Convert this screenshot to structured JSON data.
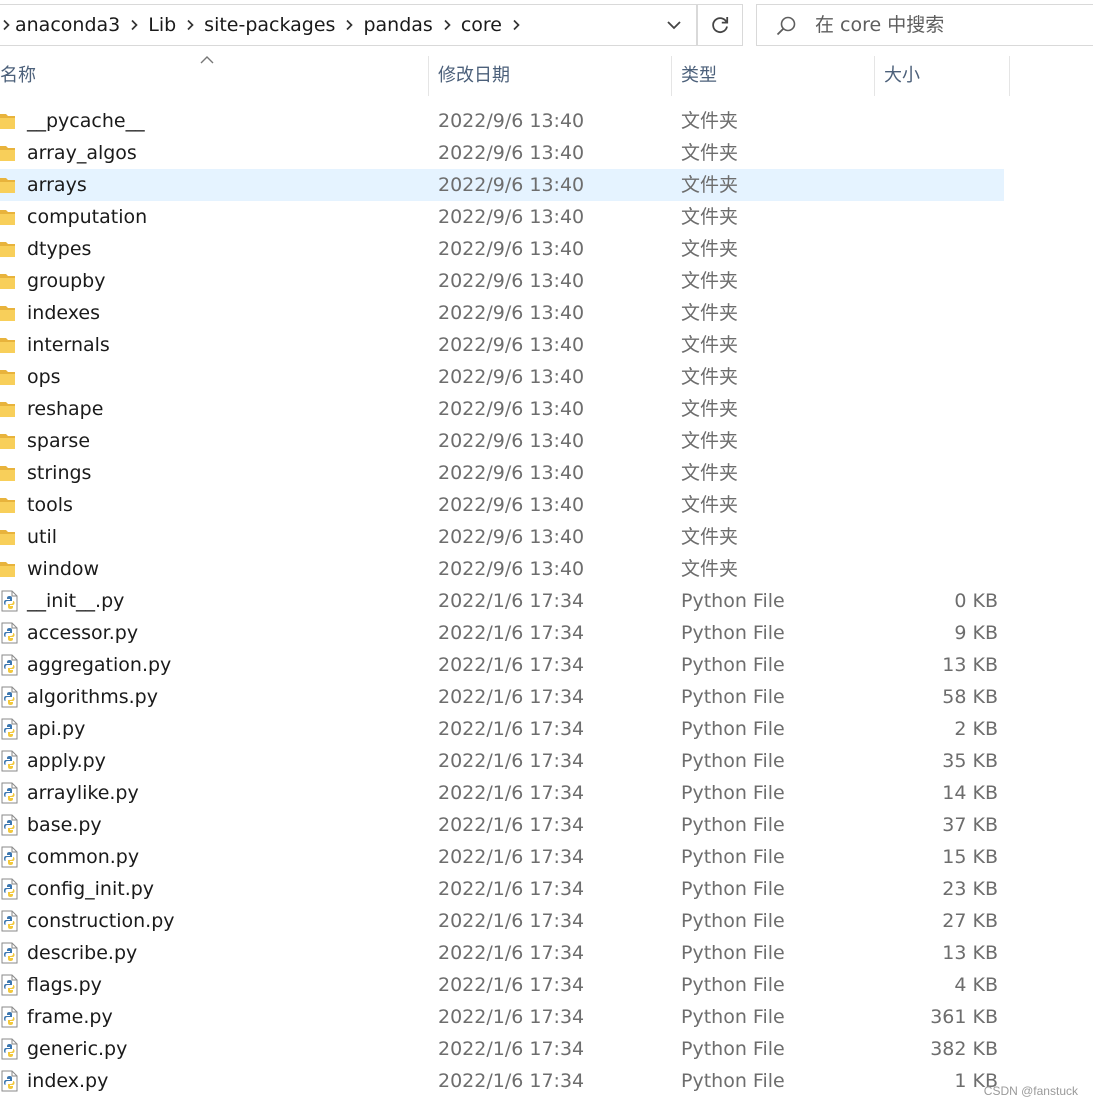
{
  "address_bar": {
    "crumbs": [
      "anaconda3",
      "Lib",
      "site-packages",
      "pandas",
      "core"
    ]
  },
  "search": {
    "placeholder": "在 core 中搜索"
  },
  "columns": {
    "name": "名称",
    "date": "修改日期",
    "type": "类型",
    "size": "大小"
  },
  "sort": {
    "column": "name",
    "direction": "ascending"
  },
  "selected_row": "arrays",
  "rows": [
    {
      "name": "__pycache__",
      "date": "2022/9/6 13:40",
      "type": "文件夹",
      "size": "",
      "kind": "folder"
    },
    {
      "name": "array_algos",
      "date": "2022/9/6 13:40",
      "type": "文件夹",
      "size": "",
      "kind": "folder"
    },
    {
      "name": "arrays",
      "date": "2022/9/6 13:40",
      "type": "文件夹",
      "size": "",
      "kind": "folder"
    },
    {
      "name": "computation",
      "date": "2022/9/6 13:40",
      "type": "文件夹",
      "size": "",
      "kind": "folder"
    },
    {
      "name": "dtypes",
      "date": "2022/9/6 13:40",
      "type": "文件夹",
      "size": "",
      "kind": "folder"
    },
    {
      "name": "groupby",
      "date": "2022/9/6 13:40",
      "type": "文件夹",
      "size": "",
      "kind": "folder"
    },
    {
      "name": "indexes",
      "date": "2022/9/6 13:40",
      "type": "文件夹",
      "size": "",
      "kind": "folder"
    },
    {
      "name": "internals",
      "date": "2022/9/6 13:40",
      "type": "文件夹",
      "size": "",
      "kind": "folder"
    },
    {
      "name": "ops",
      "date": "2022/9/6 13:40",
      "type": "文件夹",
      "size": "",
      "kind": "folder"
    },
    {
      "name": "reshape",
      "date": "2022/9/6 13:40",
      "type": "文件夹",
      "size": "",
      "kind": "folder"
    },
    {
      "name": "sparse",
      "date": "2022/9/6 13:40",
      "type": "文件夹",
      "size": "",
      "kind": "folder"
    },
    {
      "name": "strings",
      "date": "2022/9/6 13:40",
      "type": "文件夹",
      "size": "",
      "kind": "folder"
    },
    {
      "name": "tools",
      "date": "2022/9/6 13:40",
      "type": "文件夹",
      "size": "",
      "kind": "folder"
    },
    {
      "name": "util",
      "date": "2022/9/6 13:40",
      "type": "文件夹",
      "size": "",
      "kind": "folder"
    },
    {
      "name": "window",
      "date": "2022/9/6 13:40",
      "type": "文件夹",
      "size": "",
      "kind": "folder"
    },
    {
      "name": "__init__.py",
      "date": "2022/1/6 17:34",
      "type": "Python File",
      "size": "0 KB",
      "kind": "python"
    },
    {
      "name": "accessor.py",
      "date": "2022/1/6 17:34",
      "type": "Python File",
      "size": "9 KB",
      "kind": "python"
    },
    {
      "name": "aggregation.py",
      "date": "2022/1/6 17:34",
      "type": "Python File",
      "size": "13 KB",
      "kind": "python"
    },
    {
      "name": "algorithms.py",
      "date": "2022/1/6 17:34",
      "type": "Python File",
      "size": "58 KB",
      "kind": "python"
    },
    {
      "name": "api.py",
      "date": "2022/1/6 17:34",
      "type": "Python File",
      "size": "2 KB",
      "kind": "python"
    },
    {
      "name": "apply.py",
      "date": "2022/1/6 17:34",
      "type": "Python File",
      "size": "35 KB",
      "kind": "python"
    },
    {
      "name": "arraylike.py",
      "date": "2022/1/6 17:34",
      "type": "Python File",
      "size": "14 KB",
      "kind": "python"
    },
    {
      "name": "base.py",
      "date": "2022/1/6 17:34",
      "type": "Python File",
      "size": "37 KB",
      "kind": "python"
    },
    {
      "name": "common.py",
      "date": "2022/1/6 17:34",
      "type": "Python File",
      "size": "15 KB",
      "kind": "python"
    },
    {
      "name": "config_init.py",
      "date": "2022/1/6 17:34",
      "type": "Python File",
      "size": "23 KB",
      "kind": "python"
    },
    {
      "name": "construction.py",
      "date": "2022/1/6 17:34",
      "type": "Python File",
      "size": "27 KB",
      "kind": "python"
    },
    {
      "name": "describe.py",
      "date": "2022/1/6 17:34",
      "type": "Python File",
      "size": "13 KB",
      "kind": "python"
    },
    {
      "name": "flags.py",
      "date": "2022/1/6 17:34",
      "type": "Python File",
      "size": "4 KB",
      "kind": "python"
    },
    {
      "name": "frame.py",
      "date": "2022/1/6 17:34",
      "type": "Python File",
      "size": "361 KB",
      "kind": "python"
    },
    {
      "name": "generic.py",
      "date": "2022/1/6 17:34",
      "type": "Python File",
      "size": "382 KB",
      "kind": "python"
    },
    {
      "name": "index.py",
      "date": "2022/1/6 17:34",
      "type": "Python File",
      "size": "1 KB",
      "kind": "python"
    }
  ],
  "icons": {
    "folder": "folder-icon",
    "python": "python-file-icon",
    "search": "search-icon",
    "refresh": "refresh-icon",
    "dropdown": "chevron-down-icon",
    "separator": "chevron-right-icon"
  },
  "colors": {
    "folder": "#f8cf5a",
    "selection": "#e5f3ff",
    "header_text": "#4c607a"
  },
  "watermark": "CSDN @fanstuck"
}
